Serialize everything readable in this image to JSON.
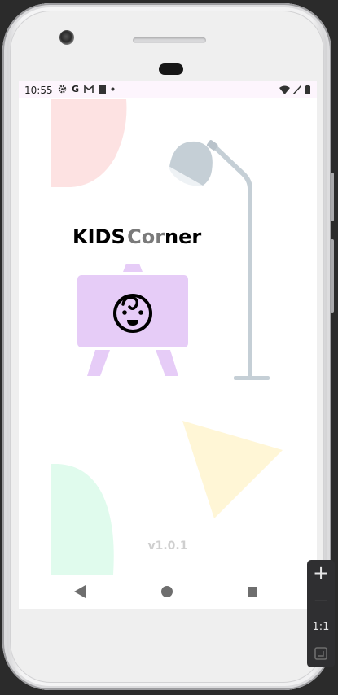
{
  "status_bar": {
    "time": "10:55",
    "left_icons": [
      "gear-icon",
      "google-g-icon",
      "gmail-icon",
      "sd-card-icon",
      "dot-icon"
    ],
    "right_icons": [
      "wifi-icon",
      "signal-icon",
      "battery-icon"
    ]
  },
  "app": {
    "title_kids": "KIDS",
    "title_cor": "Cor",
    "title_ner": "ner",
    "version": "v1.0.1"
  },
  "emulator_zoom": {
    "zoom_in": "+",
    "zoom_out": "—",
    "one_to_one": "1:1"
  },
  "colors": {
    "pink_shape": "#fde2e2",
    "lamp": "#c5cfd6",
    "easel": "#e6ccf7",
    "yellow_shape": "#fff6d6",
    "green_shape": "#e0fbed",
    "title_accent": "#7a7a7a"
  }
}
